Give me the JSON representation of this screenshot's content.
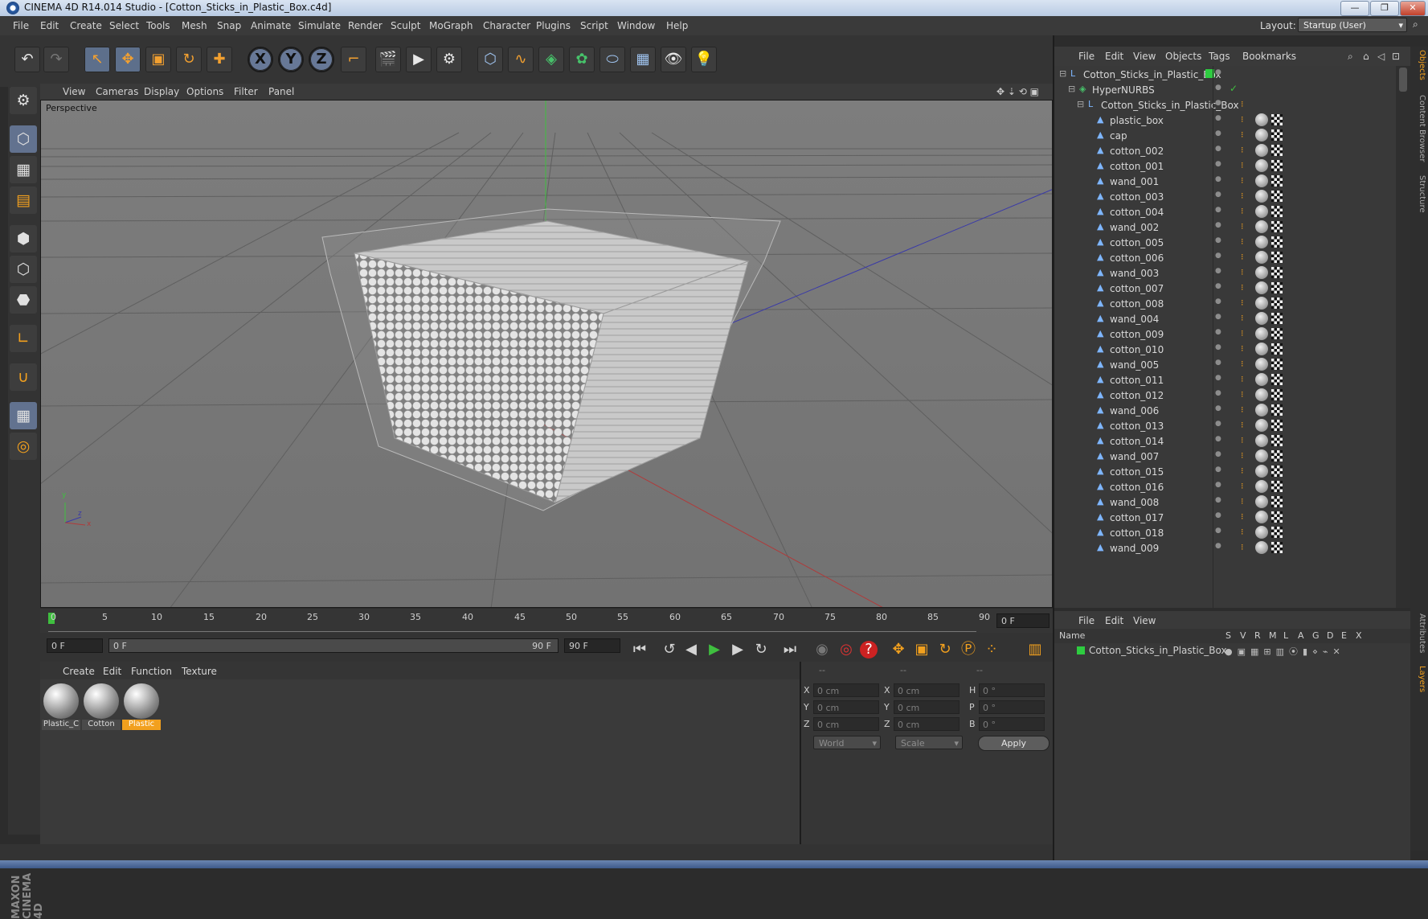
{
  "window": {
    "title": "CINEMA 4D R14.014 Studio - [Cotton_Sticks_in_Plastic_Box.c4d]"
  },
  "menu": [
    "File",
    "Edit",
    "Create",
    "Select",
    "Tools",
    "Mesh",
    "Snap",
    "Animate",
    "Simulate",
    "Render",
    "Sculpt",
    "MoGraph",
    "Character",
    "Plugins",
    "Script",
    "Window",
    "Help"
  ],
  "layout": {
    "label": "Layout:",
    "value": "Startup (User)"
  },
  "toolbar": {
    "undo": "↶",
    "redo": "↷",
    "live_select": "↖",
    "move": "✥",
    "scale": "▣",
    "rotate": "↻",
    "add": "✚",
    "x_axis": "X",
    "y_axis": "Y",
    "z_axis": "Z",
    "coord_system": "⌐",
    "render_view": "🎬",
    "render_pv": "▶",
    "render_settings": "⚙",
    "cube": "⬡",
    "spline": "∿",
    "nurbs": "◈",
    "array": "✿",
    "deformer": "⬭",
    "floor": "▦",
    "camera": "👁",
    "light": "💡"
  },
  "viewport": {
    "menu": [
      "View",
      "Cameras",
      "Display",
      "Options",
      "Filter",
      "Panel"
    ],
    "label": "Perspective",
    "axis_x": "x",
    "axis_y": "y",
    "axis_z": "z"
  },
  "timeline": {
    "ticks": [
      "0",
      "5",
      "10",
      "15",
      "20",
      "25",
      "30",
      "35",
      "40",
      "45",
      "50",
      "55",
      "60",
      "65",
      "70",
      "75",
      "80",
      "85",
      "90"
    ],
    "frame_display": "0 F",
    "start_field": "0 F",
    "range_start": "0 F",
    "range_end": "90 F",
    "end_field": "90 F"
  },
  "playback": {
    "first": "⏮",
    "prev_key": "↺",
    "prev": "◀",
    "play": "▶",
    "next": "▶",
    "next_key": "↻",
    "last": "⏭",
    "record": "◉",
    "autokey": "◎",
    "help": "?"
  },
  "material_manager": {
    "menu": [
      "Create",
      "Edit",
      "Function",
      "Texture"
    ],
    "materials": [
      {
        "name": "Plastic_C"
      },
      {
        "name": "Cotton"
      },
      {
        "name": "Plastic"
      }
    ]
  },
  "coordinates": {
    "headers": [
      "--",
      "--",
      "--"
    ],
    "rows": [
      {
        "label_a": "X",
        "val_a": "0 cm",
        "label_b": "X",
        "val_b": "0 cm",
        "label_c": "H",
        "val_c": "0 °"
      },
      {
        "label_a": "Y",
        "val_a": "0 cm",
        "label_b": "Y",
        "val_b": "0 cm",
        "label_c": "P",
        "val_c": "0 °"
      },
      {
        "label_a": "Z",
        "val_a": "0 cm",
        "label_b": "Z",
        "val_b": "0 cm",
        "label_c": "B",
        "val_c": "0 °"
      }
    ],
    "space": "World",
    "mode": "Scale",
    "apply": "Apply"
  },
  "object_manager": {
    "menu": [
      "File",
      "Edit",
      "View",
      "Objects",
      "Tags",
      "Bookmarks"
    ],
    "objects": [
      {
        "name": "Cotton_Sticks_in_Plastic_Box",
        "level": 0
      },
      {
        "name": "HyperNURBS",
        "level": 1
      },
      {
        "name": "Cotton_Sticks_in_Plastic_Box",
        "level": 2
      },
      {
        "name": "plastic_box",
        "level": 3
      },
      {
        "name": "cap",
        "level": 3
      },
      {
        "name": "cotton_002",
        "level": 3
      },
      {
        "name": "cotton_001",
        "level": 3
      },
      {
        "name": "wand_001",
        "level": 3
      },
      {
        "name": "cotton_003",
        "level": 3
      },
      {
        "name": "cotton_004",
        "level": 3
      },
      {
        "name": "wand_002",
        "level": 3
      },
      {
        "name": "cotton_005",
        "level": 3
      },
      {
        "name": "cotton_006",
        "level": 3
      },
      {
        "name": "wand_003",
        "level": 3
      },
      {
        "name": "cotton_007",
        "level": 3
      },
      {
        "name": "cotton_008",
        "level": 3
      },
      {
        "name": "wand_004",
        "level": 3
      },
      {
        "name": "cotton_009",
        "level": 3
      },
      {
        "name": "cotton_010",
        "level": 3
      },
      {
        "name": "wand_005",
        "level": 3
      },
      {
        "name": "cotton_011",
        "level": 3
      },
      {
        "name": "cotton_012",
        "level": 3
      },
      {
        "name": "wand_006",
        "level": 3
      },
      {
        "name": "cotton_013",
        "level": 3
      },
      {
        "name": "cotton_014",
        "level": 3
      },
      {
        "name": "wand_007",
        "level": 3
      },
      {
        "name": "cotton_015",
        "level": 3
      },
      {
        "name": "cotton_016",
        "level": 3
      },
      {
        "name": "wand_008",
        "level": 3
      },
      {
        "name": "cotton_017",
        "level": 3
      },
      {
        "name": "cotton_018",
        "level": 3
      },
      {
        "name": "wand_009",
        "level": 3
      }
    ]
  },
  "layer_manager": {
    "menu": [
      "File",
      "Edit",
      "View"
    ],
    "columns": [
      "Name",
      "S",
      "V",
      "R",
      "M",
      "L",
      "A",
      "G",
      "D",
      "E",
      "X"
    ],
    "layers": [
      {
        "name": "Cotton_Sticks_in_Plastic_Box"
      }
    ]
  },
  "right_tabs": [
    "Objects",
    "Content Browser",
    "Structure",
    "Attributes",
    "Layers"
  ],
  "branding": {
    "logo": "MAXON CINEMA 4D"
  },
  "colors": {
    "accent": "#f2a01e",
    "selection": "#62728f",
    "layer_green": "#2ecc40"
  }
}
